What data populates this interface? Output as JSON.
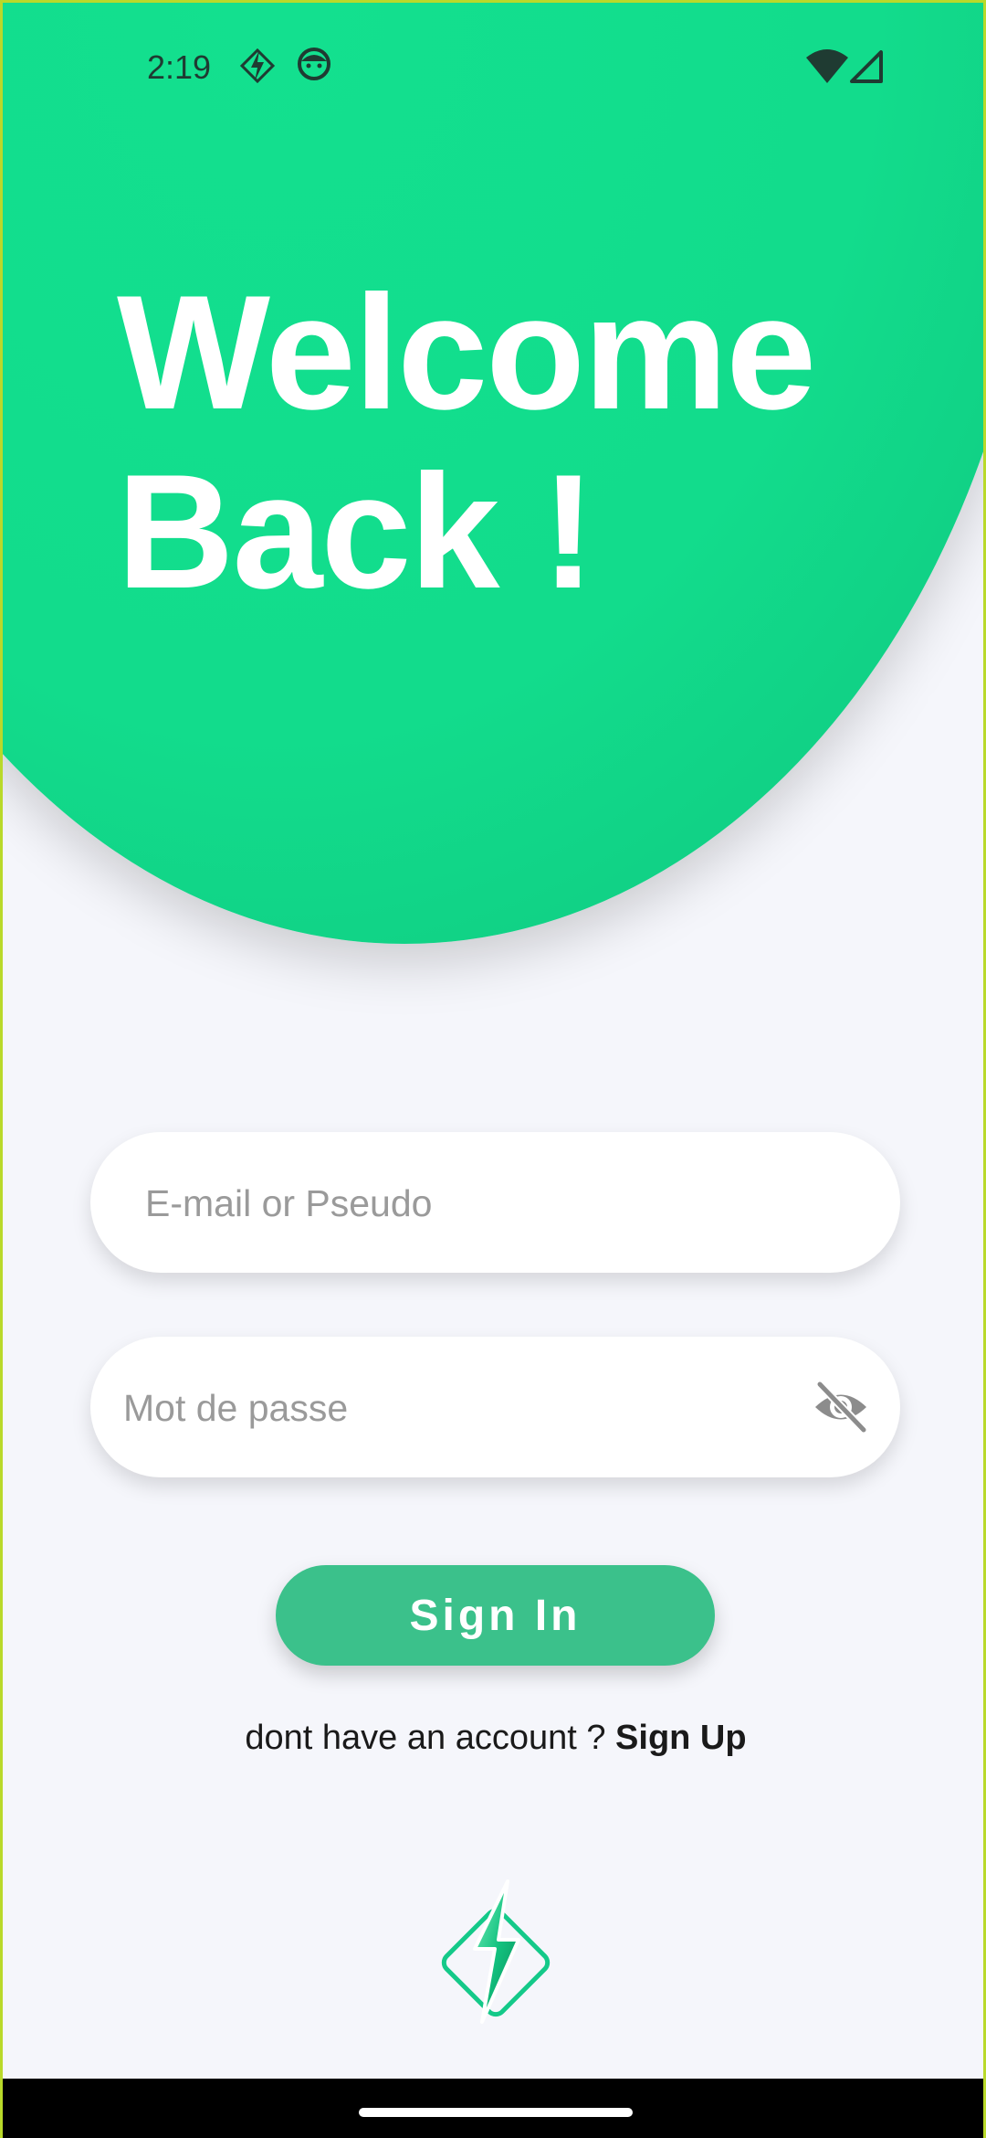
{
  "status_bar": {
    "time": "2:19",
    "left_icons": [
      "bolt-diamond-icon",
      "face-icon"
    ],
    "right_icons": [
      "wifi-icon",
      "cell-signal-icon"
    ]
  },
  "header": {
    "title_line1": "Welcome",
    "title_line2": "Back !",
    "background_color": "#12DC8C"
  },
  "form": {
    "email_placeholder": "E-mail or Pseudo",
    "email_value": "",
    "password_placeholder": "Mot de passe",
    "password_value": "",
    "password_toggle_icon": "eye-off-icon",
    "sign_in_label": "Sign In",
    "sign_in_color": "#3BC18B"
  },
  "footer": {
    "prompt": "dont have an account ? ",
    "sign_up_label": "Sign Up",
    "logo": "lightning-diamond-logo"
  }
}
